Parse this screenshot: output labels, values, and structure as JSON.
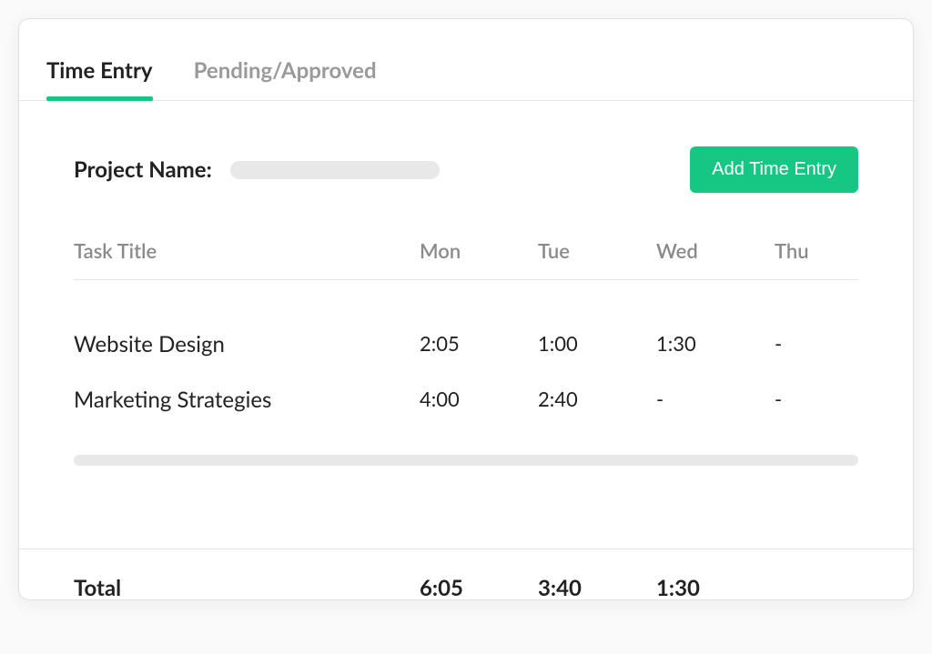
{
  "tabs": {
    "time_entry": "Time Entry",
    "pending_approved": "Pending/Approved"
  },
  "project": {
    "label": "Project Name:",
    "value": ""
  },
  "buttons": {
    "add_time_entry": "Add Time Entry"
  },
  "table": {
    "headers": {
      "task_title": "Task Title",
      "mon": "Mon",
      "tue": "Tue",
      "wed": "Wed",
      "thu": "Thu"
    },
    "rows": [
      {
        "task": "Website Design",
        "mon": "2:05",
        "tue": "1:00",
        "wed": "1:30",
        "thu": "-"
      },
      {
        "task": "Marketing Strategies",
        "mon": "4:00",
        "tue": "2:40",
        "wed": "-",
        "thu": "-"
      }
    ],
    "totals": {
      "label": "Total",
      "mon": "6:05",
      "tue": "3:40",
      "wed": "1:30",
      "thu": ""
    }
  }
}
